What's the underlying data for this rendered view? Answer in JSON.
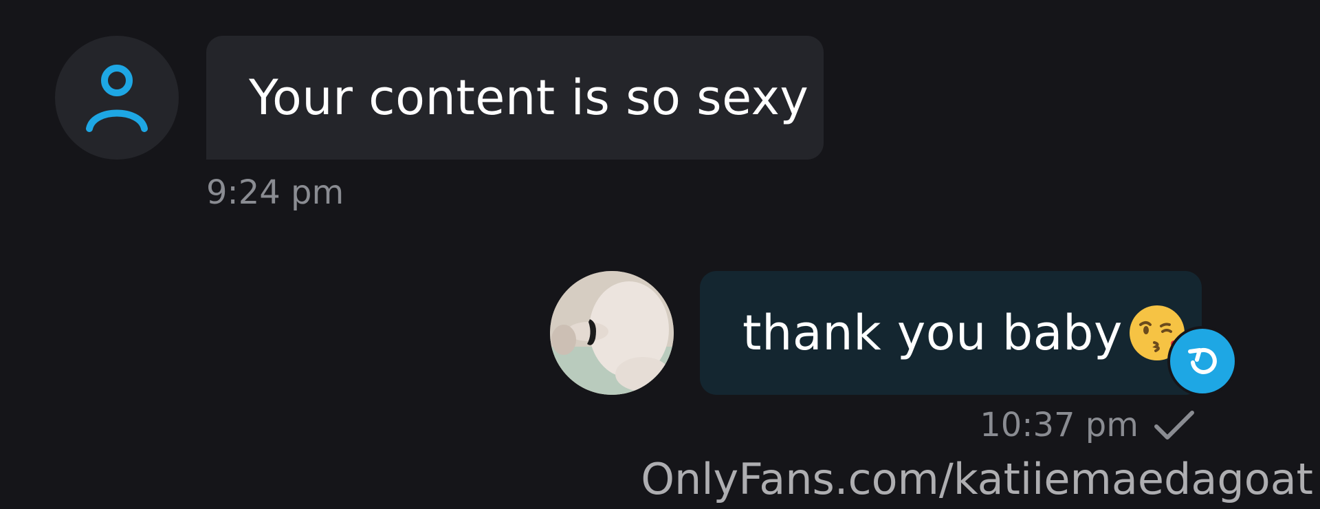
{
  "messages": {
    "incoming": {
      "text": "Your content is so sexy",
      "time": "9:24 pm",
      "avatar_icon": "user-icon"
    },
    "outgoing": {
      "text": "thank you baby",
      "emoji": "face-blowing-kiss-emoji",
      "time": "10:37 pm",
      "status_icon": "check-icon",
      "reply_icon": "undo-icon"
    }
  },
  "watermark": "OnlyFans.com/katiiemaedagoat",
  "colors": {
    "background": "#151519",
    "incoming_bubble": "#24252a",
    "outgoing_bubble": "#142630",
    "accent": "#1ea7e4",
    "timestamp": "#8a8c92"
  }
}
